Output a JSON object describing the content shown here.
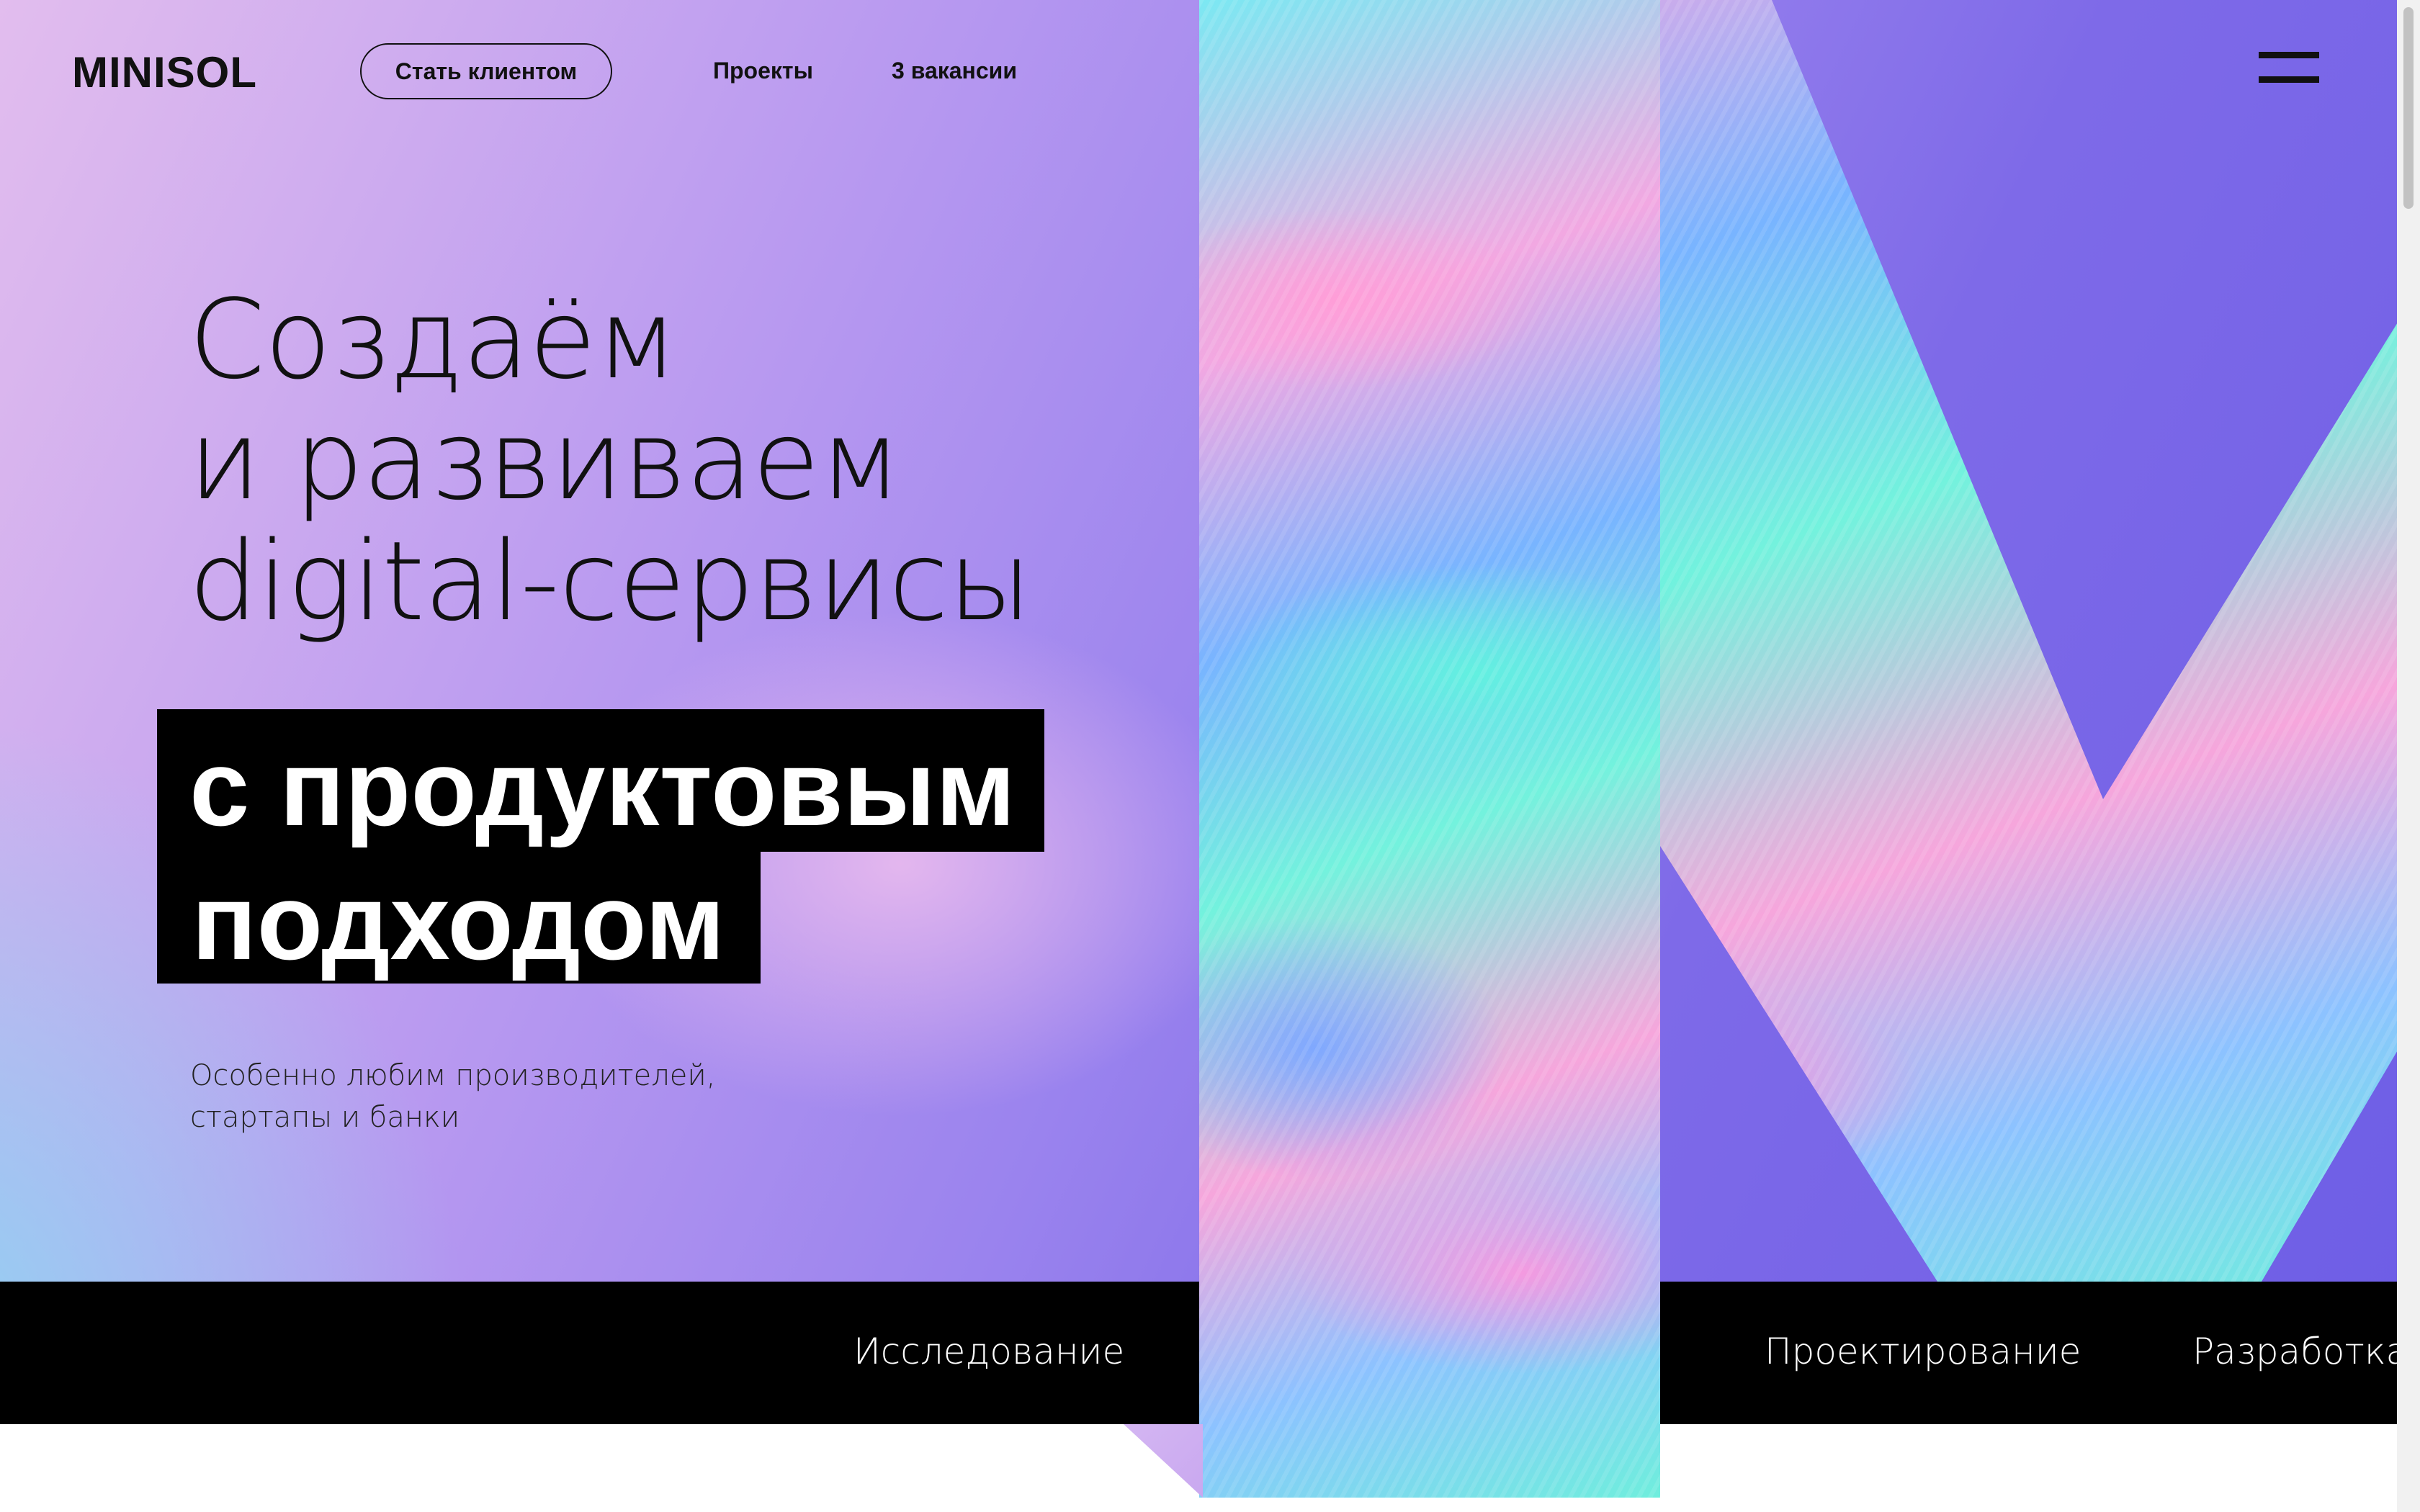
{
  "header": {
    "logo": "MINISOL",
    "cta_label": "Стать клиентом",
    "nav": [
      "Проекты",
      "3 вакансии"
    ],
    "menu_icon": "hamburger-menu-icon"
  },
  "hero": {
    "title_lines": [
      "Создаём",
      "и развиваем",
      "digital-сервисы"
    ],
    "highlight_lines": [
      "с продуктовым",
      "подходом"
    ],
    "subtitle_lines": [
      "Особенно любим производителей,",
      "стартапы и банки"
    ]
  },
  "services": [
    "Исследование",
    "Проектирование",
    "Разработка"
  ],
  "colors": {
    "gradient_pink": "#e2bdee",
    "gradient_purple": "#7e6ae8",
    "gradient_blue": "#8fd3f3",
    "iridescent_cyan": "#62f0e0",
    "iridescent_pink": "#ff9ed8",
    "text": "#111111",
    "strip": "#000000"
  }
}
